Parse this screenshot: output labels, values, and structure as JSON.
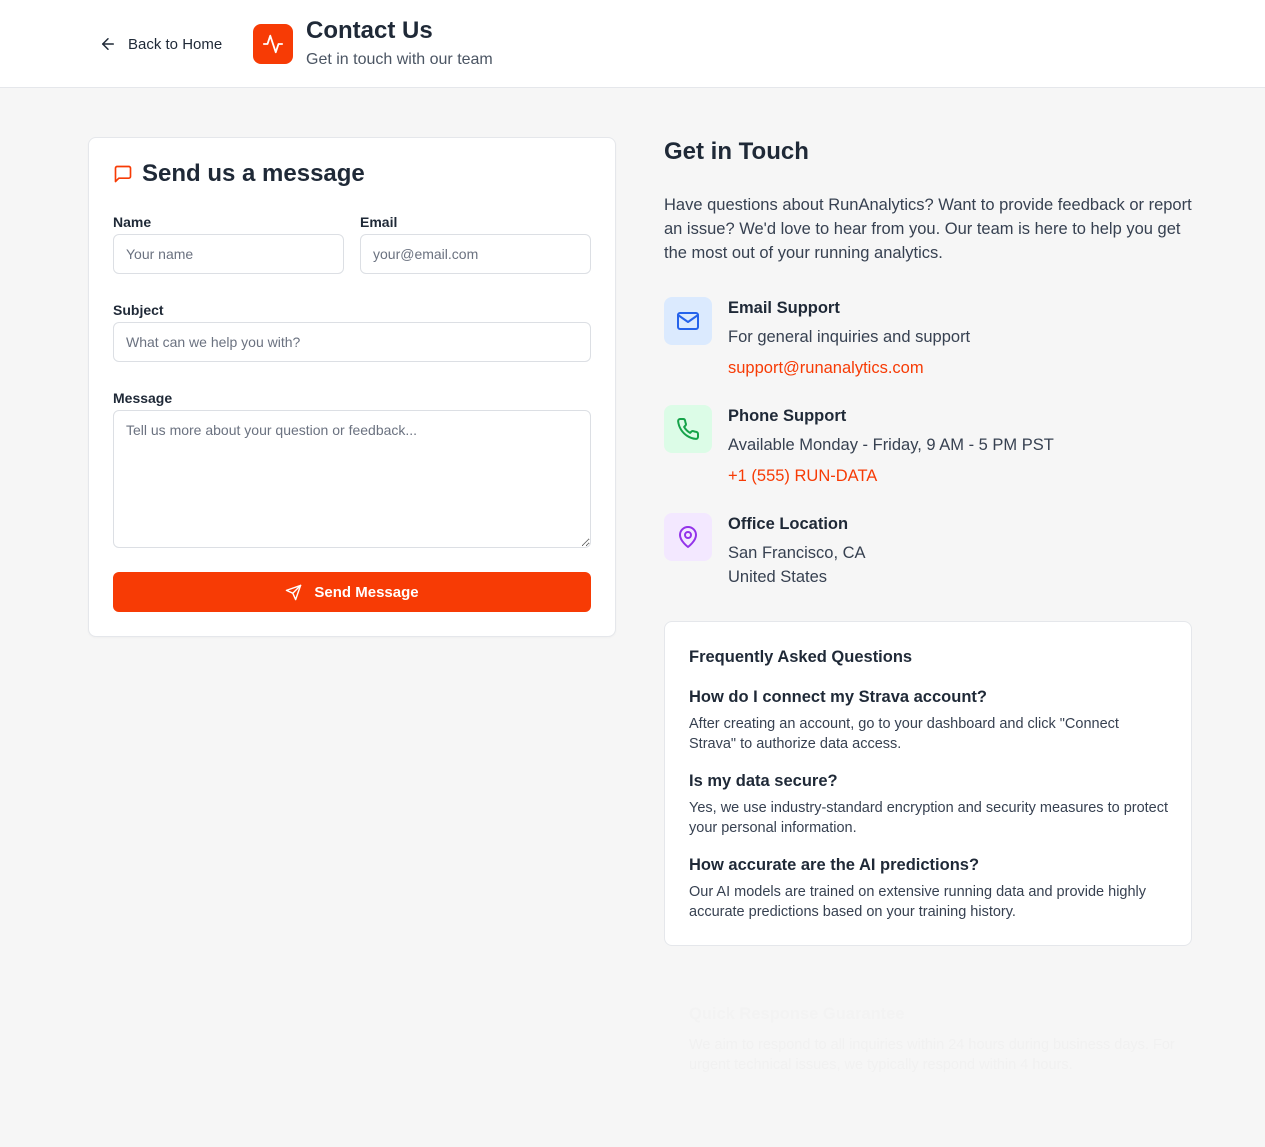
{
  "header": {
    "back_label": "Back to Home",
    "title": "Contact Us",
    "subtitle": "Get in touch with our team"
  },
  "form": {
    "title": "Send us a message",
    "name_label": "Name",
    "name_placeholder": "Your name",
    "email_label": "Email",
    "email_placeholder": "your@email.com",
    "subject_label": "Subject",
    "subject_placeholder": "What can we help you with?",
    "message_label": "Message",
    "message_placeholder": "Tell us more about your question or feedback...",
    "submit_label": "Send Message"
  },
  "contact": {
    "title": "Get in Touch",
    "intro": "Have questions about RunAnalytics? Want to provide feedback or report an issue? We'd love to hear from you. Our team is here to help you get the most out of your running analytics.",
    "email": {
      "icon": "mail-icon",
      "title": "Email Support",
      "text": "For general inquiries and support",
      "link": "support@runanalytics.com"
    },
    "phone": {
      "icon": "phone-icon",
      "title": "Phone Support",
      "text": "Available Monday - Friday, 9 AM - 5 PM PST",
      "link": "+1 (555) RUN-DATA"
    },
    "office": {
      "icon": "map-pin-icon",
      "title": "Office Location",
      "line1": "San Francisco, CA",
      "line2": "United States"
    }
  },
  "faq": {
    "title": "Frequently Asked Questions",
    "items": [
      {
        "q": "How do I connect my Strava account?",
        "a": "After creating an account, go to your dashboard and click \"Connect Strava\" to authorize data access."
      },
      {
        "q": "Is my data secure?",
        "a": "Yes, we use industry-standard encryption and security measures to protect your personal information."
      },
      {
        "q": "How accurate are the AI predictions?",
        "a": "Our AI models are trained on extensive running data and provide highly accurate predictions based on your training history."
      }
    ]
  },
  "guarantee": {
    "title": "Quick Response Guarantee",
    "text": "We aim to respond to all inquiries within 24 hours during business days. For urgent technical issues, we typically respond within 4 hours."
  },
  "colors": {
    "accent": "#f73b05",
    "page_bg": "#f6f6f6",
    "mail_icon_bg": "#dbeafe",
    "phone_icon_bg": "#dcfce7",
    "pin_icon_bg": "#f3e8ff"
  }
}
